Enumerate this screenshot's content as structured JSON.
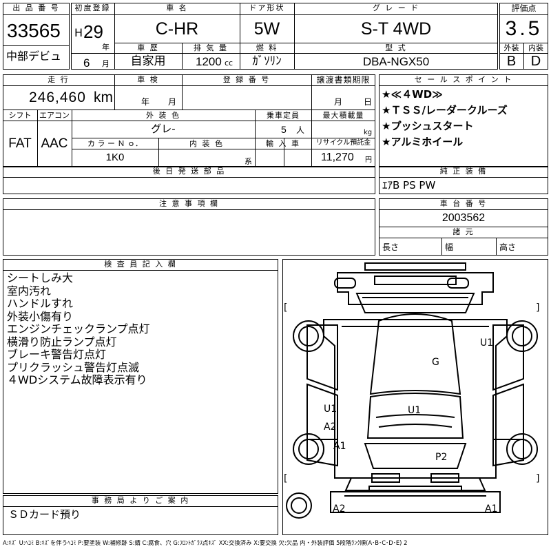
{
  "lot": {
    "header": "出 品 番 号",
    "number": "33565",
    "debut": "中部デビュ"
  },
  "first_reg": {
    "header": "初度登録",
    "era": "H",
    "year": "29",
    "year_unit": "年",
    "month": "6",
    "month_unit": "月"
  },
  "car_name": {
    "header": "車 名",
    "value": "C-HR"
  },
  "door": {
    "header": "ドア形状",
    "value": "5W"
  },
  "grade": {
    "header": "グ レ ー ド",
    "value": "S-T 4WD"
  },
  "rating": {
    "header": "評価点",
    "value": "3.5",
    "ext_header": "外装",
    "int_header": "内装",
    "ext": "B",
    "int": "D"
  },
  "history": {
    "header": "車 歴",
    "value": "自家用"
  },
  "displacement": {
    "header": "排 気 量",
    "value": "1200",
    "unit": "cc"
  },
  "fuel": {
    "header": "燃 料",
    "value": "ｶﾞｿﾘﾝ"
  },
  "model": {
    "header": "型 式",
    "value": "DBA-NGX50"
  },
  "mileage": {
    "header": "走 行",
    "value": "246,460",
    "unit": "km"
  },
  "inspection": {
    "header": "車 検",
    "year_unit": "年",
    "month_unit": "月"
  },
  "registration": {
    "header": "登 録 番 号",
    "value": ""
  },
  "transfer": {
    "header": "譲渡書類期限",
    "month_unit": "月",
    "day_unit": "日"
  },
  "shift": {
    "header": "シフト",
    "value": "FAT"
  },
  "aircon": {
    "header": "エアコン",
    "value": "AAC"
  },
  "exterior_color": {
    "header": "外 装 色",
    "value": "グレ-"
  },
  "capacity": {
    "header": "乗車定員",
    "value": "5",
    "unit": "人"
  },
  "max_load": {
    "header": "最大積載量",
    "value": "",
    "unit": "kg"
  },
  "color_no": {
    "header": "カ ラ ー Ｎ ｏ．",
    "value": "1K0"
  },
  "interior_color": {
    "header": "内 装 色",
    "value": "",
    "unit": "系"
  },
  "import": {
    "header": "輸 入 車",
    "value": ""
  },
  "recycle": {
    "header": "リサイクル預託金",
    "value": "11,270",
    "unit": "円"
  },
  "sales_points": {
    "header": "セ ー ル ス ポ イ ン ト",
    "items": [
      "★≪４WD≫",
      "★ＴＳＳ/レーダークルーズ",
      "★プッシュスタート",
      "★アルミホイール"
    ]
  },
  "later_parts": {
    "header": "後 日 発 送 部 品",
    "value": ""
  },
  "genuine": {
    "header": "純 正 装 備",
    "value": "ｴｱB PS PW"
  },
  "notes": {
    "header": "注 意 事 項 欄",
    "value": ""
  },
  "chassis": {
    "header": "車 台 番 号",
    "value": "2003562"
  },
  "dimensions": {
    "header": "諸 元",
    "length": "長さ",
    "width": "幅",
    "height": "高さ"
  },
  "inspector": {
    "header": "検 査 員 記 入 欄",
    "lines": [
      "シートしみ大",
      "室内汚れ",
      "ハンドルすれ",
      "外装小傷有り",
      "エンジンチェックランプ点灯",
      "横滑り防止ランプ点灯",
      "ブレーキ警告灯点灯",
      "プリクラッシュ警告灯点滅",
      "４WDシステム故障表示有り"
    ]
  },
  "office": {
    "header": "事 務 局 よ り ご 案 内",
    "value": "ＳＤカード預り"
  },
  "diagram": {
    "marks": {
      "U1_right_front": "U1",
      "G": "G",
      "U1_left": "U1",
      "A2_left": "A2",
      "U1_roof": "U1",
      "A1_left": "A1",
      "P2": "P2",
      "A2_rear": "A2",
      "A1_rear": "A1"
    },
    "bracket_l": "[",
    "bracket_r": "]"
  },
  "legend": "A:ｷｽﾞ U:ﾍｺﾐ B:ｷｽﾞを伴うﾍｺﾐ P:要塗装 W:補修跡 S:錆 C:腐食、穴 G:ﾌﾛﾝﾄｶﾞﾗｽ点ｷｽﾞ XX:交換済み X:要交換 欠:欠品 内・外装評価 5段階ﾗﾝｸ順(A･B･C･D･E) 2"
}
